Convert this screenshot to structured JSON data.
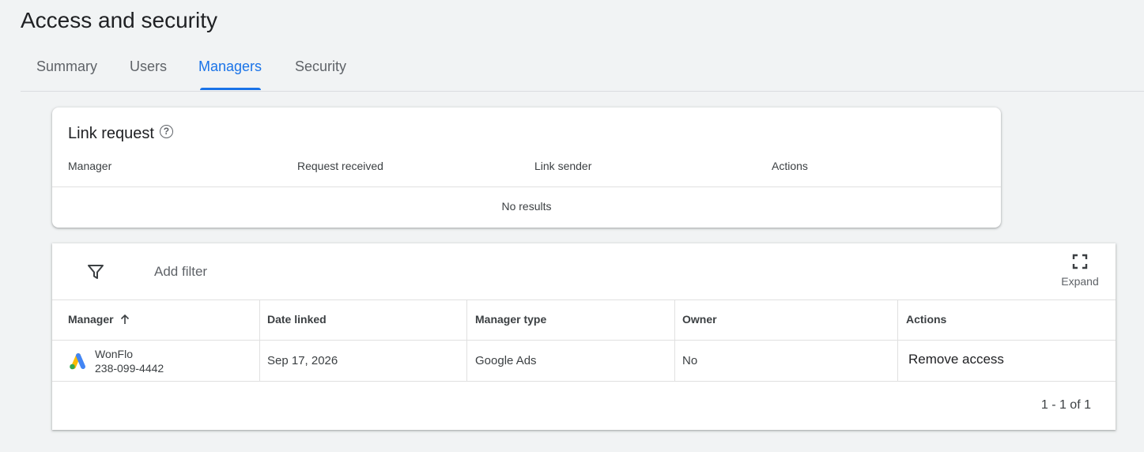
{
  "page": {
    "title": "Access and security"
  },
  "tabs": [
    {
      "label": "Summary"
    },
    {
      "label": "Users"
    },
    {
      "label": "Managers",
      "active": true
    },
    {
      "label": "Security"
    }
  ],
  "link_request": {
    "title": "Link request",
    "columns": [
      "Manager",
      "Request received",
      "Link sender",
      "Actions"
    ],
    "empty_text": "No results"
  },
  "managers": {
    "add_filter_label": "Add filter",
    "expand_label": "Expand",
    "columns": [
      "Manager",
      "Date linked",
      "Manager type",
      "Owner",
      "Actions"
    ],
    "rows": [
      {
        "name": "WonFlo",
        "account_id": "238-099-4442",
        "date_linked": "Sep 17, 2026",
        "manager_type": "Google Ads",
        "owner": "No",
        "action": "Remove access"
      }
    ],
    "pagination": "1 - 1 of 1"
  },
  "colors": {
    "accent": "#1a73e8",
    "background": "#f1f3f4"
  },
  "icons": [
    "help-icon",
    "filter-icon",
    "expand-icon",
    "arrow-up-icon",
    "google-ads-logo"
  ]
}
